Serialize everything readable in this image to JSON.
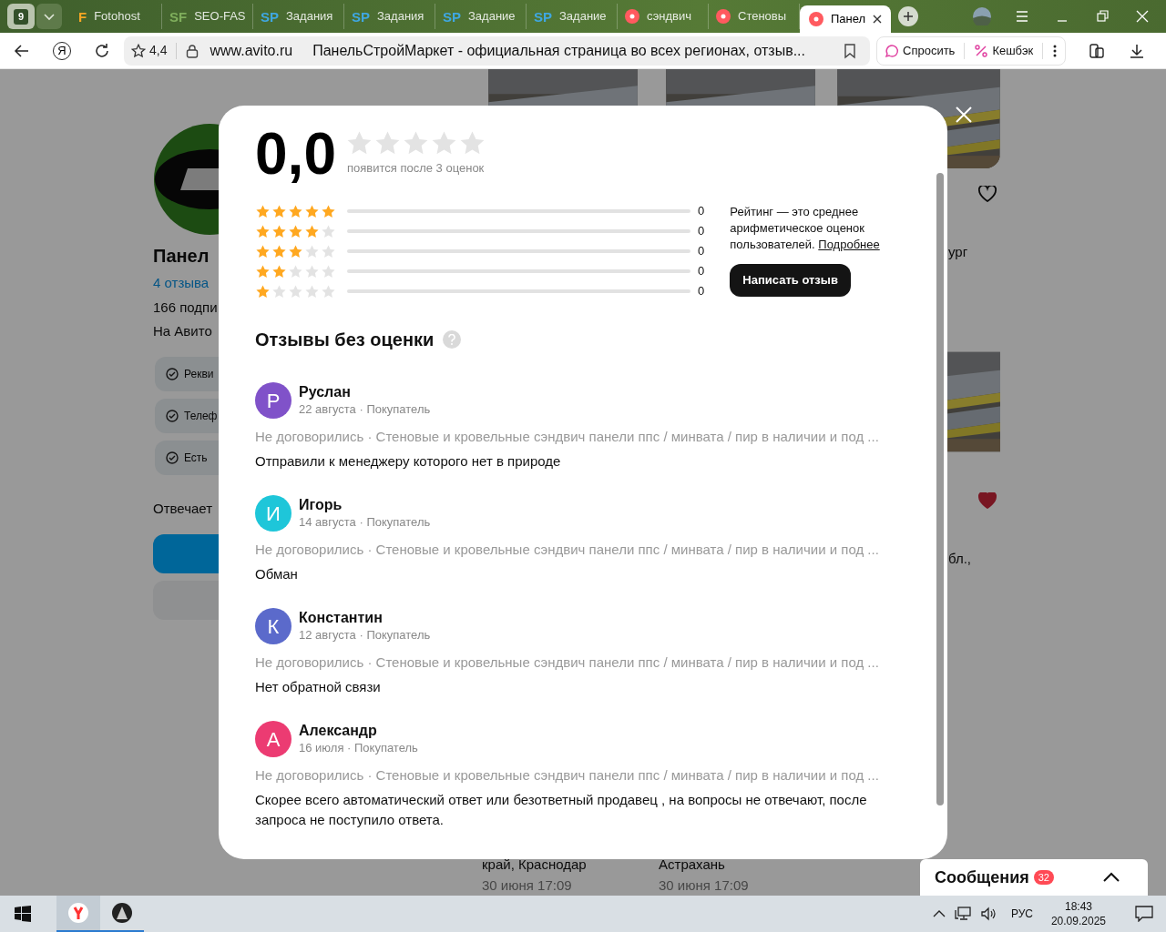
{
  "browser": {
    "tab_count": "9",
    "tabs": [
      {
        "title": "Fotohost",
        "favicon": {
          "kind": "letters",
          "text": "F",
          "color": "#f5a623"
        },
        "selected": false
      },
      {
        "title": "SEO-FAS",
        "favicon": {
          "kind": "letters",
          "text": "SF",
          "color": "#7fae5c"
        },
        "selected": false
      },
      {
        "title": "Задания",
        "favicon": {
          "kind": "letters",
          "text": "SP",
          "color": "#3fa7e0"
        },
        "selected": false
      },
      {
        "title": "Задания",
        "favicon": {
          "kind": "letters",
          "text": "SP",
          "color": "#3fa7e0"
        },
        "selected": false
      },
      {
        "title": "Задание",
        "favicon": {
          "kind": "letters",
          "text": "SP",
          "color": "#3fa7e0"
        },
        "selected": false
      },
      {
        "title": "Задание",
        "favicon": {
          "kind": "letters",
          "text": "SP",
          "color": "#3fa7e0"
        },
        "selected": false
      },
      {
        "title": "сэндвич",
        "favicon": {
          "kind": "dot",
          "color": "#ff5a5f"
        },
        "selected": false
      },
      {
        "title": "Стеновы",
        "favicon": {
          "kind": "dot",
          "color": "#ff5a5f"
        },
        "selected": false
      },
      {
        "title": "Панел",
        "favicon": {
          "kind": "dot",
          "color": "#ff5a5f"
        },
        "selected": true
      }
    ],
    "yandex_button": "Я",
    "site_rating": "4,4",
    "domain": "www.avito.ru",
    "page_title": "ПанельСтройМаркет - официальная страница во всех регионах, отзыв...",
    "toolbar_buttons": [
      {
        "kind": "ask",
        "label": "Спросить"
      },
      {
        "kind": "cashback",
        "label": "Кешбэк"
      }
    ]
  },
  "background_page": {
    "seller_name": "Панел",
    "reviews_link": "4 отзыва",
    "subscribers": "166 подпи",
    "on_avito": "На Авито",
    "badges": [
      "Рекви",
      "Телеф",
      "Есть"
    ],
    "response_time": "Отвечает",
    "listing_fragments": [
      "ург",
      "бл.,"
    ],
    "favorites": [
      {
        "favorited": false
      },
      {
        "favorited": true
      }
    ],
    "listings": [
      {
        "location": "край, Краснодар",
        "date": "30 июня 17:09"
      },
      {
        "location": "Астрахань",
        "date": "30 июня 17:09"
      }
    ]
  },
  "reviews_modal": {
    "score": "0,0",
    "stars": 0,
    "score_note": "появится после 3 оценок",
    "distribution": [
      {
        "stars": 5,
        "level": 0,
        "count": "0"
      },
      {
        "stars": 4,
        "level": 0,
        "count": "0"
      },
      {
        "stars": 3,
        "level": 0,
        "count": "0"
      },
      {
        "stars": 2,
        "level": 0,
        "count": "0"
      },
      {
        "stars": 1,
        "level": 0,
        "count": "0"
      }
    ],
    "rating_info": "Рейтинг — это среднее арифметическое оценок пользователей.",
    "more_link": "Подробнее",
    "write_button": "Написать отзыв",
    "section_title": "Отзывы без оценки",
    "reviews": [
      {
        "initial": "Р",
        "color": "#8052c9",
        "name": "Руслан",
        "meta": "22 августа · Покупатель",
        "context": "Не договорились · Стеновые и кровельные сэндвич панели ппс / минвата / пир в наличии и под ...",
        "text": "Отправили к менеджеру которого нет в природе"
      },
      {
        "initial": "И",
        "color": "#1ec6d9",
        "name": "Игорь",
        "meta": "14 августа · Покупатель",
        "context": "Не договорились · Стеновые и кровельные сэндвич панели ппс / минвата / пир в наличии и под ...",
        "text": "Обман"
      },
      {
        "initial": "К",
        "color": "#5b6acb",
        "name": "Константин",
        "meta": "12 августа · Покупатель",
        "context": "Не договорились · Стеновые и кровельные сэндвич панели ппс / минвата / пир в наличии и под ...",
        "text": "Нет обратной связи"
      },
      {
        "initial": "А",
        "color": "#ec3b72",
        "name": "Александр",
        "meta": "16 июля · Покупатель",
        "context": "Не договорились · Стеновые и кровельные сэндвич панели ппс / минвата / пир в наличии и под ...",
        "text": "Скорее всего автоматический ответ или безответный продавец , на вопросы не отвечают, после запроса не поступило ответа."
      }
    ]
  },
  "messages_widget": {
    "title": "Сообщения",
    "badge": "32"
  },
  "taskbar": {
    "language": "РУС",
    "time": "18:43",
    "date": "20.09.2025"
  }
}
